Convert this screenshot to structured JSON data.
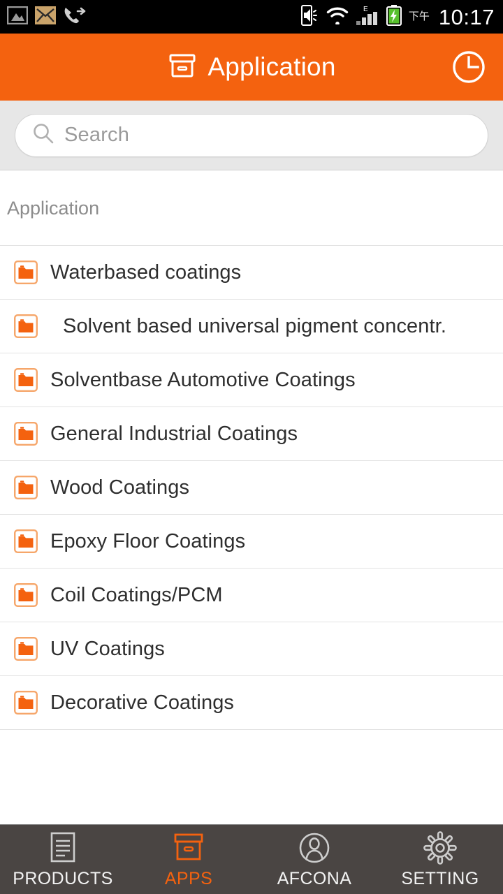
{
  "statusbar": {
    "left_icons": [
      {
        "name": "gallery-image-icon",
        "glyph": "image"
      },
      {
        "name": "email-icon",
        "glyph": "envelope"
      },
      {
        "name": "call-forward-icon",
        "glyph": "call-forward"
      }
    ],
    "right_icons": [
      {
        "name": "phone-sound-icon",
        "glyph": "phone-sound"
      },
      {
        "name": "wifi-icon",
        "glyph": "wifi"
      },
      {
        "name": "cellular-signal-icon",
        "glyph": "signal",
        "network_label": "E"
      },
      {
        "name": "battery-charging-icon",
        "glyph": "battery-charging",
        "color": "#57c02d"
      }
    ],
    "ampm": "下午",
    "time": "10:17"
  },
  "header": {
    "title": "Application",
    "icon": "archive-box-icon",
    "action_icon": "clock-icon",
    "bg_color": "#f4620f",
    "text_color": "#ffffff"
  },
  "search": {
    "placeholder": "Search",
    "value": "",
    "icon": "search-icon"
  },
  "main": {
    "section_title": "Application",
    "items": [
      {
        "label": "Waterbased coatings",
        "icon": "folder-icon",
        "indent": false
      },
      {
        "label": "Solvent based universal pigment concentr.",
        "icon": "folder-icon",
        "indent": true
      },
      {
        "label": "Solventbase Automotive Coatings",
        "icon": "folder-icon",
        "indent": false
      },
      {
        "label": "General Industrial Coatings",
        "icon": "folder-icon",
        "indent": false
      },
      {
        "label": "Wood Coatings",
        "icon": "folder-icon",
        "indent": false
      },
      {
        "label": "Epoxy Floor Coatings",
        "icon": "folder-icon",
        "indent": false
      },
      {
        "label": "Coil Coatings/PCM",
        "icon": "folder-icon",
        "indent": false
      },
      {
        "label": "UV Coatings",
        "icon": "folder-icon",
        "indent": false
      },
      {
        "label": "Decorative Coatings",
        "icon": "folder-icon",
        "indent": false
      }
    ]
  },
  "bottom_nav": {
    "active_index": 1,
    "active_color": "#f4620f",
    "inactive_color": "#f2f2f2",
    "bg_color": "#4a4543",
    "items": [
      {
        "label": "PRODUCTS",
        "icon": "document-lines-icon"
      },
      {
        "label": "APPS",
        "icon": "archive-box-icon"
      },
      {
        "label": "AFCONA",
        "icon": "person-circle-icon"
      },
      {
        "label": "SETTING",
        "icon": "gear-icon"
      }
    ]
  }
}
